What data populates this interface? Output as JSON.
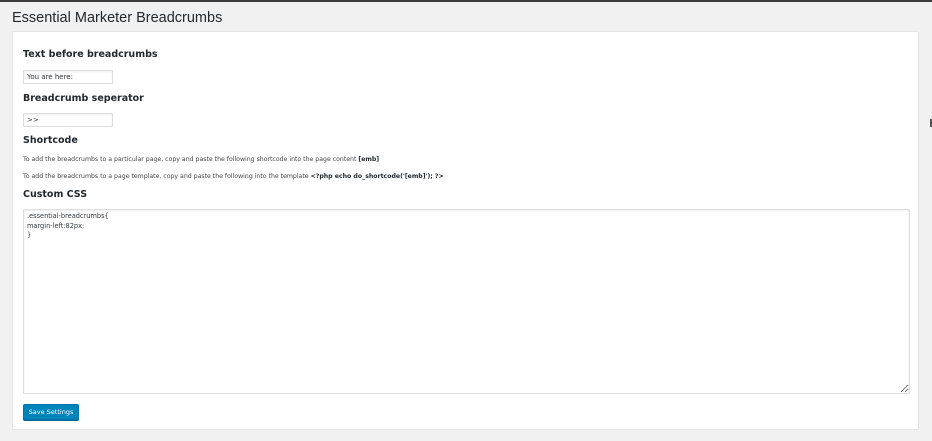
{
  "page": {
    "title": "Essential Marketer Breadcrumbs"
  },
  "fields": {
    "text_before": {
      "label": "Text before breadcrumbs",
      "value": "You are here:"
    },
    "separator": {
      "label": "Breadcrumb seperator",
      "value": ">>"
    }
  },
  "shortcode": {
    "heading": "Shortcode",
    "line1_text": "To add the breadcrumbs to a particular page, copy and paste the following shortcode into the page content",
    "line1_code": "[emb]",
    "line2_text": "To add the breadcrumbs to a page template, copy and paste the following into the template",
    "line2_code": "<?php echo do_shortcode('[emb]'); ?>"
  },
  "custom_css": {
    "label": "Custom CSS",
    "value": ".essential-breadcrumbs{\nmargin-left:82px;\n}"
  },
  "actions": {
    "save_label": "Save Settings"
  },
  "colors": {
    "primary_button": "#0085ba",
    "background": "#f1f1f1",
    "panel": "#ffffff"
  }
}
